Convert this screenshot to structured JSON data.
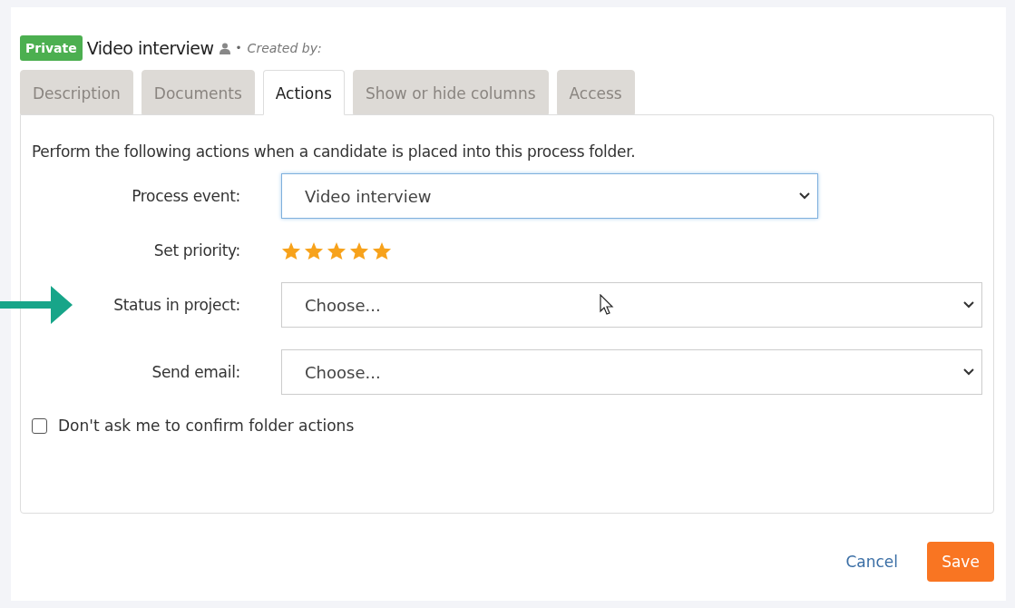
{
  "header": {
    "badge": "Private",
    "title": "Video interview",
    "separator": "•",
    "created_by": "Created by:"
  },
  "tabs": [
    {
      "label": "Description",
      "selected": false
    },
    {
      "label": "Documents",
      "selected": false
    },
    {
      "label": "Actions",
      "selected": true
    },
    {
      "label": "Show or hide columns",
      "selected": false
    },
    {
      "label": "Access",
      "selected": false
    }
  ],
  "intro": "Perform the following actions when a candidate is placed into this process folder.",
  "fields": [
    {
      "kind": "select",
      "label": "Process event:",
      "value": "Video interview",
      "focused": true,
      "wide": false,
      "highlighted": false
    },
    {
      "kind": "stars",
      "label": "Set priority:",
      "stars": 5
    },
    {
      "kind": "select",
      "label": "Status in project:",
      "placeholder": "Choose...",
      "focused": false,
      "wide": true,
      "highlighted": true
    },
    {
      "kind": "select",
      "label": "Send email:",
      "placeholder": "Choose...",
      "focused": false,
      "wide": true,
      "highlighted": false
    }
  ],
  "confirm_checkbox": {
    "label": "Don't ask me to confirm folder actions",
    "checked": false
  },
  "buttons": {
    "cancel": "Cancel",
    "save": "Save"
  }
}
